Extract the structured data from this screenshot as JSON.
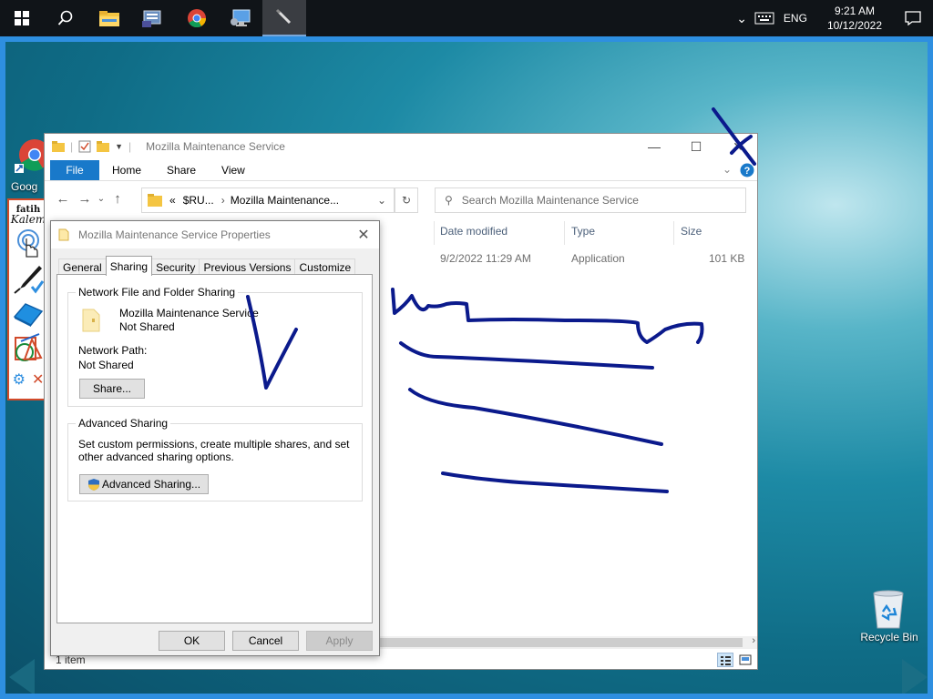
{
  "taskbar": {
    "language": "ENG",
    "time": "9:21 AM",
    "date": "10/12/2022"
  },
  "desktop": {
    "chrome_icon_label_partial": "Goog\nChr",
    "recycle_bin_label": "Recycle Bin"
  },
  "kalem": {
    "logo_top": "fatih",
    "logo_bottom": "Kalem"
  },
  "explorer": {
    "title": "Mozilla Maintenance Service",
    "ribbon_tabs": {
      "file": "File",
      "home": "Home",
      "share": "Share",
      "view": "View"
    },
    "address": {
      "prefix": "«",
      "crumb1": "$RU...",
      "sep": "›",
      "crumb2": "Mozilla Maintenance..."
    },
    "search_placeholder": "Search Mozilla Maintenance Service",
    "columns": {
      "date": "Date modified",
      "type": "Type",
      "size": "Size"
    },
    "row": {
      "date": "9/2/2022 11:29 AM",
      "type": "Application",
      "size": "101 KB"
    },
    "status": "1 item"
  },
  "properties": {
    "title": "Mozilla Maintenance Service Properties",
    "tabs": [
      "General",
      "Sharing",
      "Security",
      "Previous Versions",
      "Customize"
    ],
    "network_group_title": "Network File and Folder Sharing",
    "item_name": "Mozilla Maintenance Service",
    "item_state": "Not Shared",
    "network_path_label": "Network Path:",
    "network_path_value": "Not Shared",
    "share_button": "Share...",
    "advanced_group_title": "Advanced Sharing",
    "advanced_description": "Set custom permissions, create multiple shares, and set other advanced sharing options.",
    "advanced_button": "Advanced Sharing...",
    "ok": "OK",
    "cancel": "Cancel",
    "apply": "Apply"
  },
  "colors": {
    "accent": "#1979ca",
    "frame": "#2e8fe0",
    "ink": "#0b1a8c",
    "kalem_border": "#d14a2a"
  }
}
